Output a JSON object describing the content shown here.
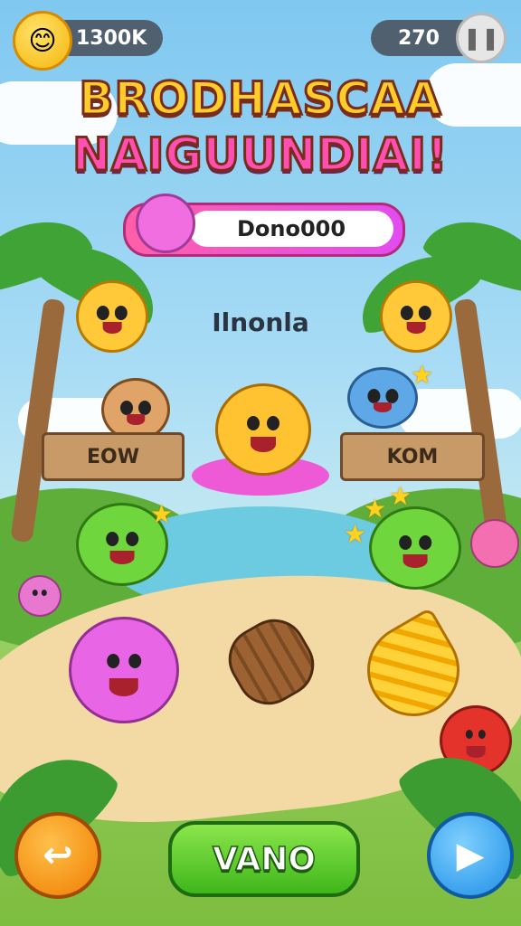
{
  "hud": {
    "coins": "1300K",
    "score": "270",
    "pause_symbol": "❚❚",
    "coin_icon": "smiley-coin-icon"
  },
  "title": {
    "line1": "BRODHASCAA",
    "line2": "NAIGUUNDIAI!"
  },
  "banner": {
    "label": "Dono000"
  },
  "level": {
    "label": "Ilnonla"
  },
  "signs": {
    "left": "EOW",
    "right": "KOM"
  },
  "controls": {
    "back_symbol": "↩",
    "play_label": "VANO",
    "forward_symbol": "▶"
  },
  "colors": {
    "accent_green": "#3eb61b",
    "accent_pink": "#ff5fa8",
    "accent_yellow": "#ffcd2a"
  }
}
